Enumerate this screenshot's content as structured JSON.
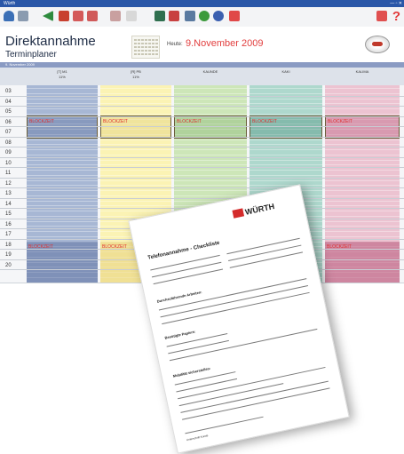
{
  "window": {
    "title": "Würth"
  },
  "toolbar": {
    "help_label": "?"
  },
  "header": {
    "title": "Direktannahme",
    "subtitle": "Terminplaner",
    "today_label": "Heute:",
    "today_date": "9.November 2009"
  },
  "dateinfo": "9. November 2009",
  "columns": [
    {
      "name": "[T] M1",
      "pct": "11%",
      "color": "#a7b7d4"
    },
    {
      "name": "[R] PB",
      "pct": "11%",
      "color": "#fbf3b4"
    },
    {
      "name": "KAUNDE",
      "pct": "",
      "color": "#cde6b8"
    },
    {
      "name": "KAKI",
      "pct": "",
      "color": "#aed8cd"
    },
    {
      "name": "KALIMA",
      "pct": "",
      "color": "#ecc3d1"
    }
  ],
  "times": [
    "03",
    "04",
    "05",
    "06",
    "07",
    "08",
    "09",
    "10",
    "11",
    "12",
    "13",
    "14",
    "15",
    "16",
    "17",
    "18",
    "19",
    "20"
  ],
  "block_label": "BLOCKZEIT",
  "paper": {
    "brand": "WÜRTH",
    "title": "Telefonannahme - Checkliste",
    "section1": "Durchzuführende Arbeiten:",
    "section2": "Benötigte Papiere:",
    "section3": "Mobilität sicherstellen:",
    "signature_label": "Unterschrift Kunde"
  }
}
